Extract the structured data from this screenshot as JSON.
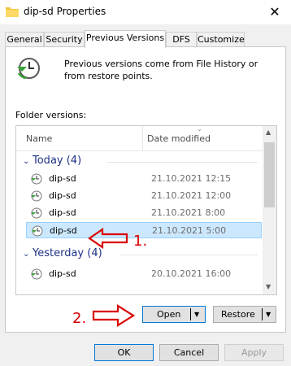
{
  "window": {
    "title": "dip-sd Properties",
    "close_glyph": "✕"
  },
  "tabs": [
    {
      "label": "General"
    },
    {
      "label": "Security"
    },
    {
      "label": "Previous Versions"
    },
    {
      "label": "DFS"
    },
    {
      "label": "Customize"
    }
  ],
  "active_tab": "Previous Versions",
  "intro_text": "Previous versions come from File History or from restore points.",
  "folder_versions_label": "Folder versions:",
  "columns": {
    "name": "Name",
    "date": "Date modified"
  },
  "groups": [
    {
      "label": "Today (4)",
      "items": [
        {
          "name": "dip-sd",
          "date": "21.10.2021 12:15"
        },
        {
          "name": "dip-sd",
          "date": "21.10.2021 12:00"
        },
        {
          "name": "dip-sd",
          "date": "21.10.2021 8:00"
        },
        {
          "name": "dip-sd",
          "date": "21.10.2021 5:00",
          "selected": true
        }
      ]
    },
    {
      "label": "Yesterday (4)",
      "items": [
        {
          "name": "dip-sd",
          "date": "20.10.2021 16:00"
        }
      ]
    }
  ],
  "buttons": {
    "open": "Open",
    "restore": "Restore",
    "ok": "OK",
    "cancel": "Cancel",
    "apply": "Apply"
  },
  "annotations": {
    "step1": "1.",
    "step2": "2."
  },
  "colors": {
    "selection_bg": "#cce8ff",
    "group_text": "#1e3287",
    "annotation": "#d90000",
    "focus_border": "#0078d7"
  }
}
